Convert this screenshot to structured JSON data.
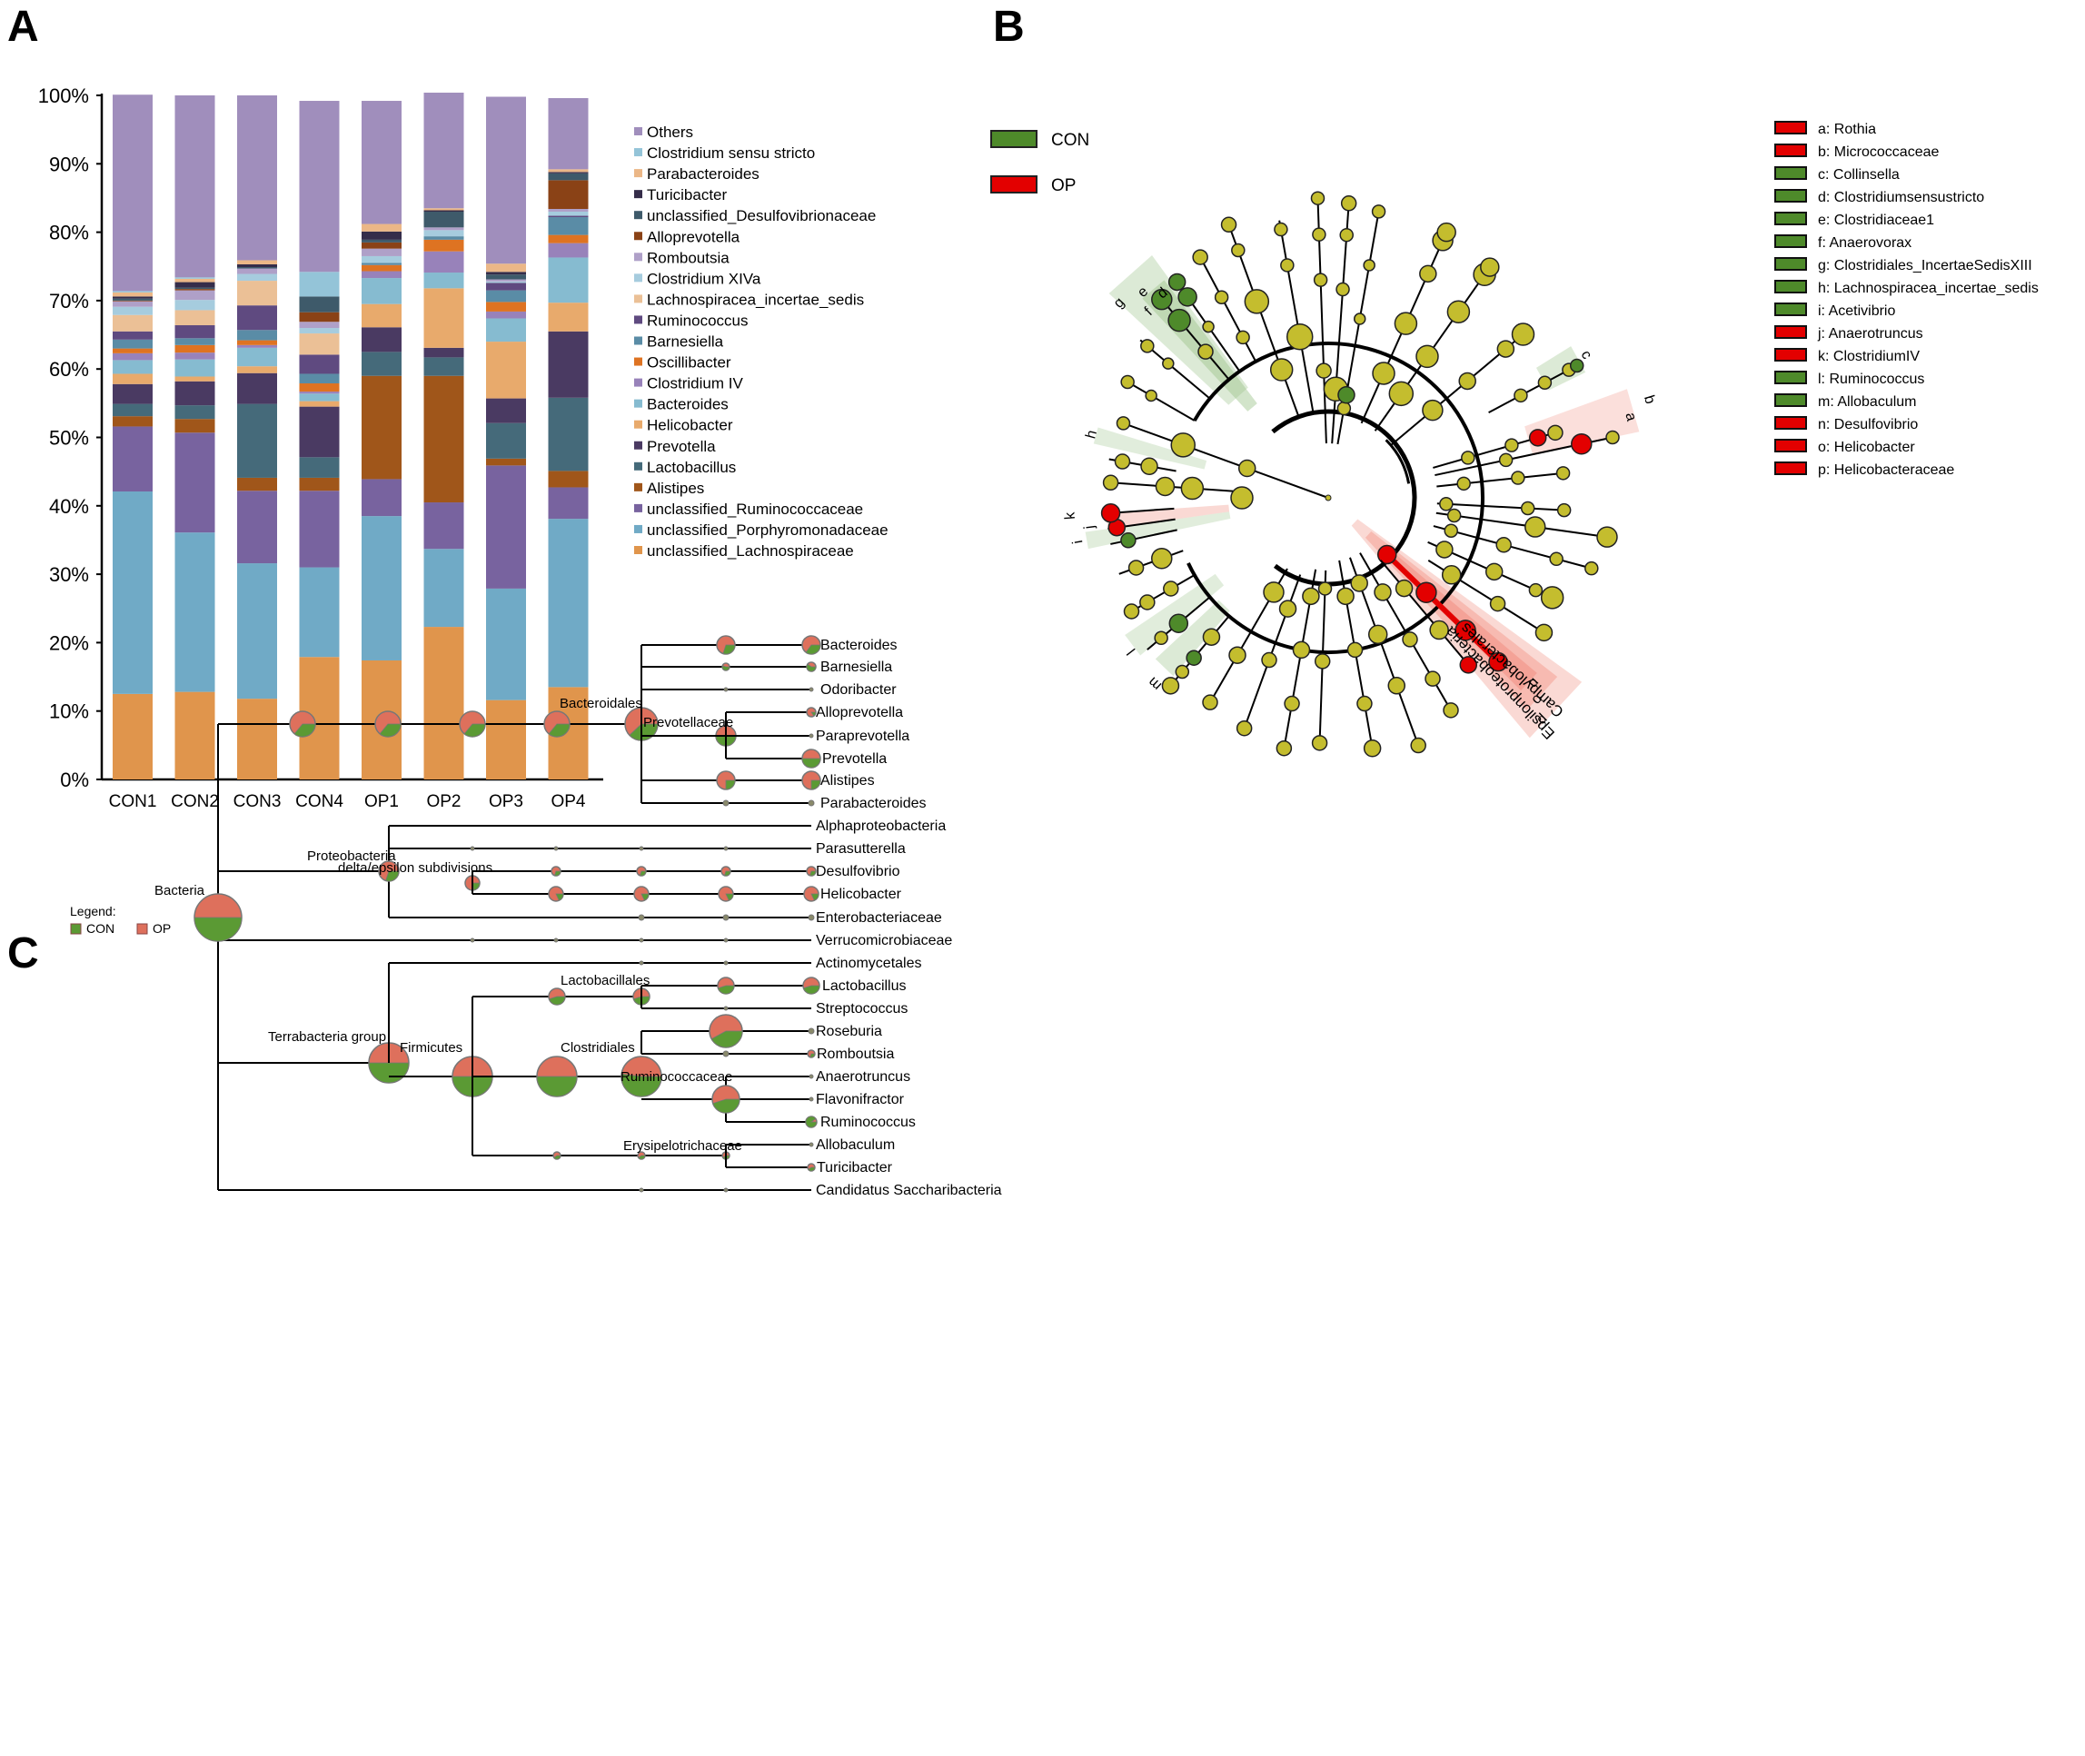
{
  "panels": {
    "a": "A",
    "b": "B",
    "c": "C"
  },
  "chart_data": [
    {
      "type": "bar",
      "stacked": true,
      "panel": "A",
      "title": "",
      "xlabel": "",
      "ylabel": "",
      "ylim": [
        0,
        100
      ],
      "yticks": [
        "0%",
        "10%",
        "20%",
        "30%",
        "40%",
        "50%",
        "60%",
        "70%",
        "80%",
        "90%",
        "100%"
      ],
      "categories": [
        "CON1",
        "CON2",
        "CON3",
        "CON4",
        "OP1",
        "OP2",
        "OP3",
        "OP4"
      ],
      "legend_position": "right",
      "series": [
        {
          "name": "unclassified_Lachnospiraceae",
          "color": "#E0954C",
          "values": [
            12.5,
            12.8,
            11.8,
            17.9,
            17.4,
            22.3,
            11.6,
            13.5
          ]
        },
        {
          "name": "unclassified_Porphyromonadaceae",
          "color": "#70AAC6",
          "values": [
            29.6,
            23.3,
            19.8,
            13.1,
            21.1,
            11.4,
            16.3,
            24.6
          ]
        },
        {
          "name": "unclassified_Ruminococcaceae",
          "color": "#78639F",
          "values": [
            9.5,
            14.6,
            10.6,
            11.2,
            5.4,
            6.8,
            18.0,
            4.6
          ]
        },
        {
          "name": "Alistipes",
          "color": "#A0561A",
          "values": [
            1.5,
            2.0,
            1.9,
            1.9,
            15.1,
            18.5,
            1.0,
            2.4
          ]
        },
        {
          "name": "Lactobacillus",
          "color": "#456A7A",
          "values": [
            1.8,
            2.0,
            10.8,
            3.0,
            3.5,
            2.7,
            5.2,
            10.7
          ]
        },
        {
          "name": "Prevotella",
          "color": "#4A3A62",
          "values": [
            2.9,
            3.5,
            4.5,
            7.4,
            3.6,
            1.4,
            3.6,
            9.7
          ]
        },
        {
          "name": "Helicobacter",
          "color": "#E8AA6C",
          "values": [
            1.5,
            0.7,
            1.0,
            0.8,
            3.4,
            8.7,
            8.3,
            4.2
          ]
        },
        {
          "name": "Bacteroides",
          "color": "#86BBD0",
          "values": [
            2.0,
            2.5,
            2.7,
            1.1,
            3.8,
            2.3,
            3.4,
            6.6
          ]
        },
        {
          "name": "Clostridium IV",
          "color": "#9882BA",
          "values": [
            1.0,
            1.0,
            0.4,
            0.3,
            1.0,
            3.1,
            1.0,
            2.1
          ]
        },
        {
          "name": "Oscillibacter",
          "color": "#DE7322",
          "values": [
            0.7,
            1.1,
            0.7,
            1.2,
            0.9,
            1.7,
            1.4,
            1.2
          ]
        },
        {
          "name": "Barnesiella",
          "color": "#5A8CA6",
          "values": [
            1.3,
            1.0,
            1.5,
            1.4,
            0.3,
            0.5,
            1.7,
            2.6
          ]
        },
        {
          "name": "Ruminococcus",
          "color": "#5F4A80",
          "values": [
            1.2,
            1.9,
            3.6,
            2.8,
            0.0,
            0.0,
            1.1,
            0.2
          ]
        },
        {
          "name": "Lachnospiracea_incertae_sedis",
          "color": "#EBC096",
          "values": [
            2.4,
            2.2,
            3.6,
            3.1,
            0.0,
            0.0,
            0.0,
            0.0
          ]
        },
        {
          "name": "Clostridium XIVa",
          "color": "#A6CCDE",
          "values": [
            1.2,
            1.5,
            1.0,
            0.8,
            1.0,
            0.9,
            0.2,
            0.6
          ]
        },
        {
          "name": "Romboutsia",
          "color": "#AFA0C8",
          "values": [
            0.8,
            1.4,
            0.8,
            0.9,
            1.1,
            0.4,
            0.3,
            0.4
          ]
        },
        {
          "name": "Alloprevotella",
          "color": "#8A4216",
          "values": [
            0.1,
            0.2,
            0.0,
            1.4,
            0.9,
            0.0,
            0.0,
            4.2
          ]
        },
        {
          "name": "unclassified_Desulfovibrionaceae",
          "color": "#3E5A6A",
          "values": [
            0.3,
            0.2,
            0.2,
            2.3,
            0.4,
            2.3,
            0.7,
            1.0
          ]
        },
        {
          "name": "Turicibacter",
          "color": "#352D4A",
          "values": [
            0.3,
            0.8,
            0.4,
            0.0,
            1.2,
            0.2,
            0.4,
            0.2
          ]
        },
        {
          "name": "Parabacteroides",
          "color": "#EBB787",
          "values": [
            0.6,
            0.5,
            0.6,
            0.0,
            1.1,
            0.3,
            1.2,
            0.4
          ]
        },
        {
          "name": "Clostridium sensu stricto",
          "color": "#94C4D8",
          "values": [
            0.2,
            0.2,
            0.0,
            3.6,
            0.0,
            0.0,
            0.0,
            0.0
          ]
        },
        {
          "name": "Others",
          "color": "#A08EBC",
          "values": [
            28.7,
            26.6,
            24.1,
            25.0,
            18.0,
            16.9,
            24.4,
            10.4
          ]
        }
      ],
      "legend_order": [
        "Others",
        "Clostridium sensu stricto",
        "Parabacteroides",
        "Turicibacter",
        "unclassified_Desulfovibrionaceae",
        "Alloprevotella",
        "Romboutsia",
        "Clostridium XIVa",
        "Lachnospiracea_incertae_sedis",
        "Ruminococcus",
        "Barnesiella",
        "Oscillibacter",
        "Clostridium IV",
        "Bacteroides",
        "Helicobacter",
        "Prevotella",
        "Lactobacillus",
        "Alistipes",
        "unclassified_Ruminococcaceae",
        "unclassified_Porphyromonadaceae",
        "unclassified_Lachnospiraceae"
      ]
    },
    {
      "type": "cladogram",
      "panel": "B",
      "group_legend": [
        {
          "label": "CON",
          "color": "#4E8A2A"
        },
        {
          "label": "OP",
          "color": "#E30000"
        }
      ],
      "node_default_color": "#C4BD2E",
      "biomarkers": [
        {
          "key": "a",
          "name": "Rothia",
          "group": "OP"
        },
        {
          "key": "b",
          "name": "Micrococcaceae",
          "group": "OP"
        },
        {
          "key": "c",
          "name": "Collinsella",
          "group": "CON"
        },
        {
          "key": "d",
          "name": "Clostridiumsensustricto",
          "group": "CON"
        },
        {
          "key": "e",
          "name": "Clostridiaceae1",
          "group": "CON"
        },
        {
          "key": "f",
          "name": "Anaerovorax",
          "group": "CON"
        },
        {
          "key": "g",
          "name": "Clostridiales_IncertaeSedisXIII",
          "group": "CON"
        },
        {
          "key": "h",
          "name": "Lachnospiracea_incertae_sedis",
          "group": "CON"
        },
        {
          "key": "i",
          "name": "Acetivibrio",
          "group": "CON"
        },
        {
          "key": "j",
          "name": "Anaerotruncus",
          "group": "OP"
        },
        {
          "key": "k",
          "name": "ClostridiumIV",
          "group": "OP"
        },
        {
          "key": "l",
          "name": "Ruminococcus",
          "group": "CON"
        },
        {
          "key": "m",
          "name": "Allobaculum",
          "group": "CON"
        },
        {
          "key": "n",
          "name": "Desulfovibrio",
          "group": "OP"
        },
        {
          "key": "o",
          "name": "Helicobacter",
          "group": "OP"
        },
        {
          "key": "p",
          "name": "Helicobacteraceae",
          "group": "OP"
        }
      ],
      "clade_labels": [
        "Campylobacterales",
        "Epsilonproteobacteria"
      ]
    },
    {
      "type": "tree",
      "panel": "C",
      "legend_title": "Legend:",
      "legend": [
        {
          "label": "CON",
          "color": "#5B9A34"
        },
        {
          "label": "OP",
          "color": "#DE705C"
        }
      ],
      "internal_labels": [
        "Bacteria",
        "Bacteroidales",
        "Prevotellaceae",
        "Proteobacteria",
        "delta/epsilon subdivisions",
        "Terrabacteria group",
        "Firmicutes",
        "Lactobacillales",
        "Clostridiales",
        "Ruminococcaceae",
        "Erysipelotrichaceae"
      ],
      "leaves": [
        "Bacteroides",
        "Barnesiella",
        "Odoribacter",
        "Alloprevotella",
        "Paraprevotella",
        "Prevotella",
        "Alistipes",
        "Parabacteroides",
        "Alphaproteobacteria",
        "Parasutterella",
        "Desulfovibrio",
        "Helicobacter",
        "Enterobacteriaceae",
        "Verrucomicrobiaceae",
        "Actinomycetales",
        "Lactobacillus",
        "Streptococcus",
        "Roseburia",
        "Romboutsia",
        "Anaerotruncus",
        "Flavonifractor",
        "Ruminococcus",
        "Allobaculum",
        "Turicibacter",
        "Candidatus Saccharibacteria"
      ]
    }
  ]
}
